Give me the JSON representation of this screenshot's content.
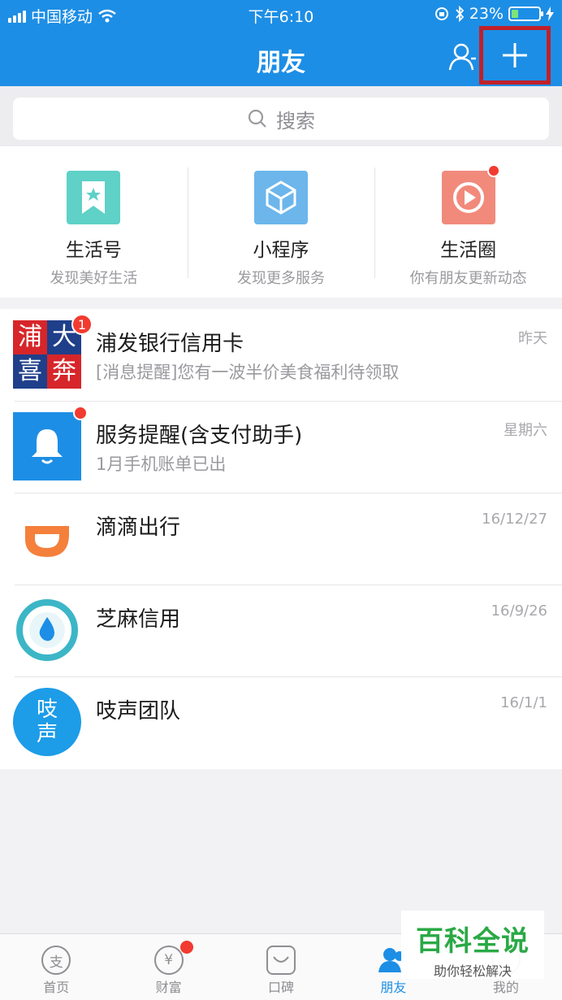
{
  "status_bar": {
    "carrier": "中国移动",
    "time": "下午6:10",
    "battery": "23%"
  },
  "header": {
    "title": "朋友",
    "contacts_icon": "contacts-icon",
    "add_icon": "plus-icon"
  },
  "search": {
    "placeholder": "搜索"
  },
  "features": [
    {
      "title": "生活号",
      "subtitle": "发现美好生活",
      "icon": "bookmark-star-icon",
      "color": "#5fd1c7"
    },
    {
      "title": "小程序",
      "subtitle": "发现更多服务",
      "icon": "cube-icon",
      "color": "#6cb6ec"
    },
    {
      "title": "生活圈",
      "subtitle": "你有朋友更新动态",
      "icon": "play-circle-icon",
      "color": "#f18a7b"
    }
  ],
  "conversations": [
    {
      "name": "浦发银行信用卡",
      "message": "[消息提醒]您有一波半价美食福利待领取",
      "time": "昨天",
      "badge": "1",
      "avatar_text": "浦大喜奔"
    },
    {
      "name": "服务提醒(含支付助手)",
      "message": "1月手机账单已出",
      "time": "星期六"
    },
    {
      "name": "滴滴出行",
      "message": "",
      "time": "16/12/27"
    },
    {
      "name": "芝麻信用",
      "message": "",
      "time": "16/9/26"
    },
    {
      "name": "吱声团队",
      "message": "",
      "time": "16/1/1",
      "avatar_text": "吱声"
    }
  ],
  "tabbar": [
    {
      "label": "首页",
      "icon": "home-icon",
      "glyph": "支"
    },
    {
      "label": "财富",
      "icon": "wealth-icon",
      "glyph": "¥"
    },
    {
      "label": "口碑",
      "icon": "koubei-icon",
      "glyph": ""
    },
    {
      "label": "朋友",
      "icon": "friends-icon",
      "glyph": ""
    },
    {
      "label": "我的",
      "icon": "profile-icon",
      "glyph": ""
    }
  ],
  "watermark": {
    "title": "百科全说",
    "subtitle": "助你轻松解决"
  },
  "colors": {
    "brand_blue": "#1d8ee5",
    "badge_red": "#f23b30",
    "highlight_box": "#c0202a"
  }
}
